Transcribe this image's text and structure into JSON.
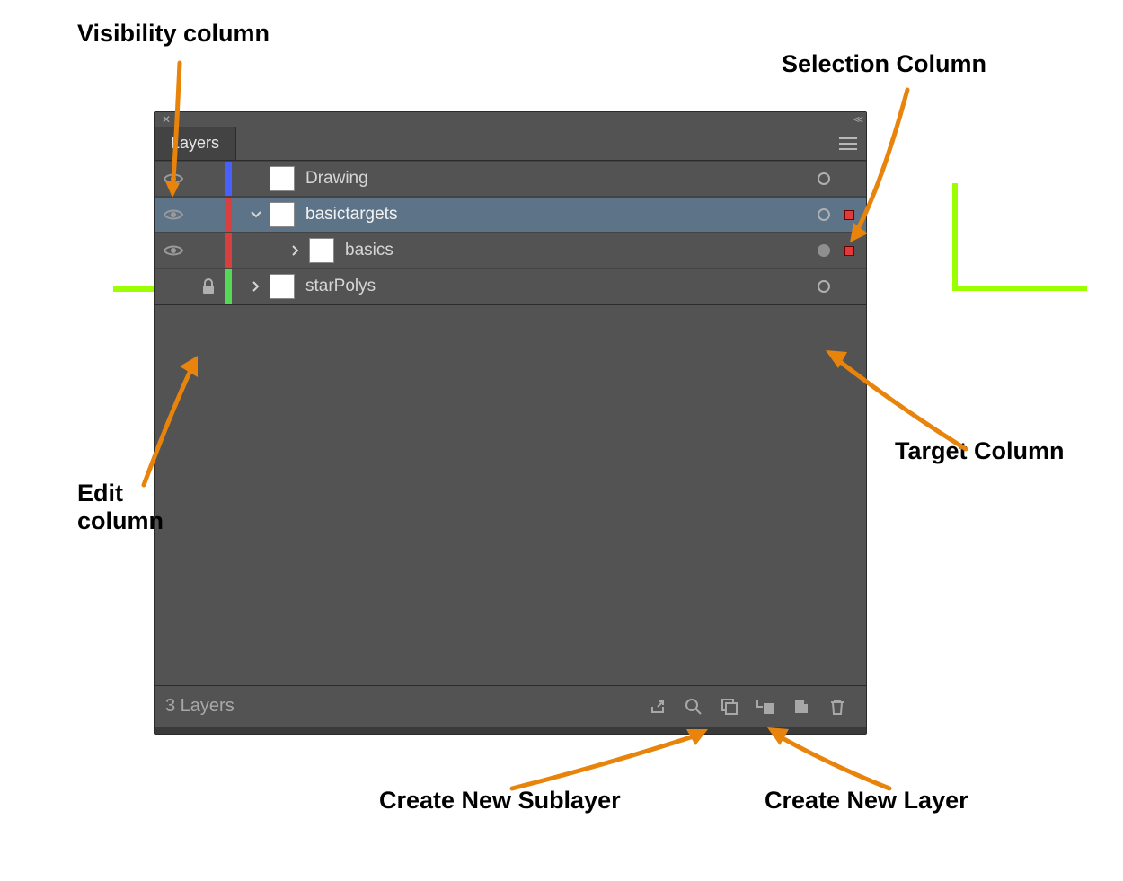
{
  "panel": {
    "tab_label": "Layers",
    "rows": [
      {
        "name": "Drawing",
        "color": "#4860ff",
        "visible": true,
        "locked": false,
        "indent": 0,
        "disclosure": "none",
        "selected": false,
        "target_filled": false,
        "has_sel_square": false,
        "sel_color": ""
      },
      {
        "name": "basictargets",
        "color": "#d84040",
        "visible": true,
        "locked": false,
        "indent": 0,
        "disclosure": "down",
        "selected": true,
        "target_filled": false,
        "has_sel_square": true,
        "sel_color": "#e03a3a"
      },
      {
        "name": "basics",
        "color": "#d84040",
        "visible": true,
        "locked": false,
        "indent": 1,
        "disclosure": "right",
        "selected": false,
        "target_filled": true,
        "has_sel_square": true,
        "sel_color": "#e03a3a"
      },
      {
        "name": "starPolys",
        "color": "#55d955",
        "visible": false,
        "locked": true,
        "indent": 0,
        "disclosure": "right",
        "selected": false,
        "target_filled": false,
        "has_sel_square": false,
        "sel_color": ""
      }
    ],
    "footer_count": "3 Layers"
  },
  "annotations": {
    "visibility": "Visibility column",
    "selection": "Selection Column",
    "edit": "Edit column",
    "target": "Target Column",
    "new_sublayer": "Create New Sublayer",
    "new_layer": "Create New Layer"
  }
}
